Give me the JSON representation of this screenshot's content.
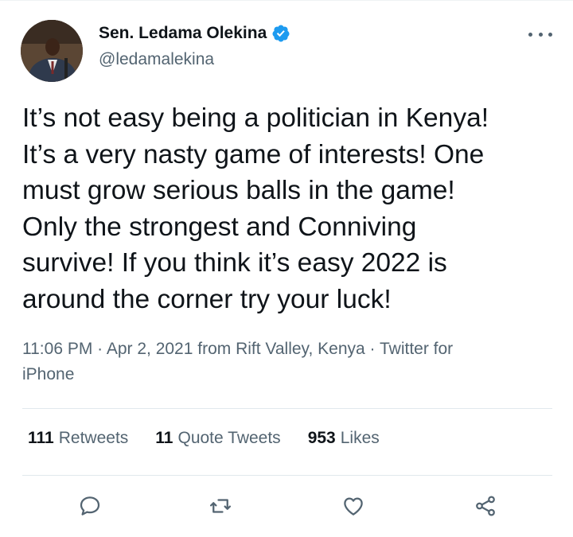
{
  "author": {
    "display_name": "Sen. Ledama Olekina",
    "handle": "@ledamalekina"
  },
  "tweet": {
    "text": "It’s not easy being a politician in Kenya!\nIt’s a very nasty game of interests!  One\nmust grow serious balls in the game!\nOnly the strongest and Conniving\nsurvive! If you think it’s easy 2022 is\naround the corner try your luck!",
    "meta_line1": "11:06 PM · Apr 2, 2021 from Rift Valley, Kenya · Twitter for",
    "meta_line2": "iPhone"
  },
  "stats": {
    "retweets_count": "111",
    "retweets_label": "Retweets",
    "quotes_count": "11",
    "quotes_label": "Quote Tweets",
    "likes_count": "953",
    "likes_label": "Likes"
  },
  "icons": {
    "verified": "verified-badge-icon",
    "more": "more-options-icon",
    "reply": "reply-icon",
    "retweet": "retweet-icon",
    "like": "heart-icon",
    "share": "share-icon"
  },
  "colors": {
    "text_primary": "#0f1419",
    "text_secondary": "#536471",
    "accent": "#1d9bf0",
    "divider": "#e1e8ed"
  }
}
